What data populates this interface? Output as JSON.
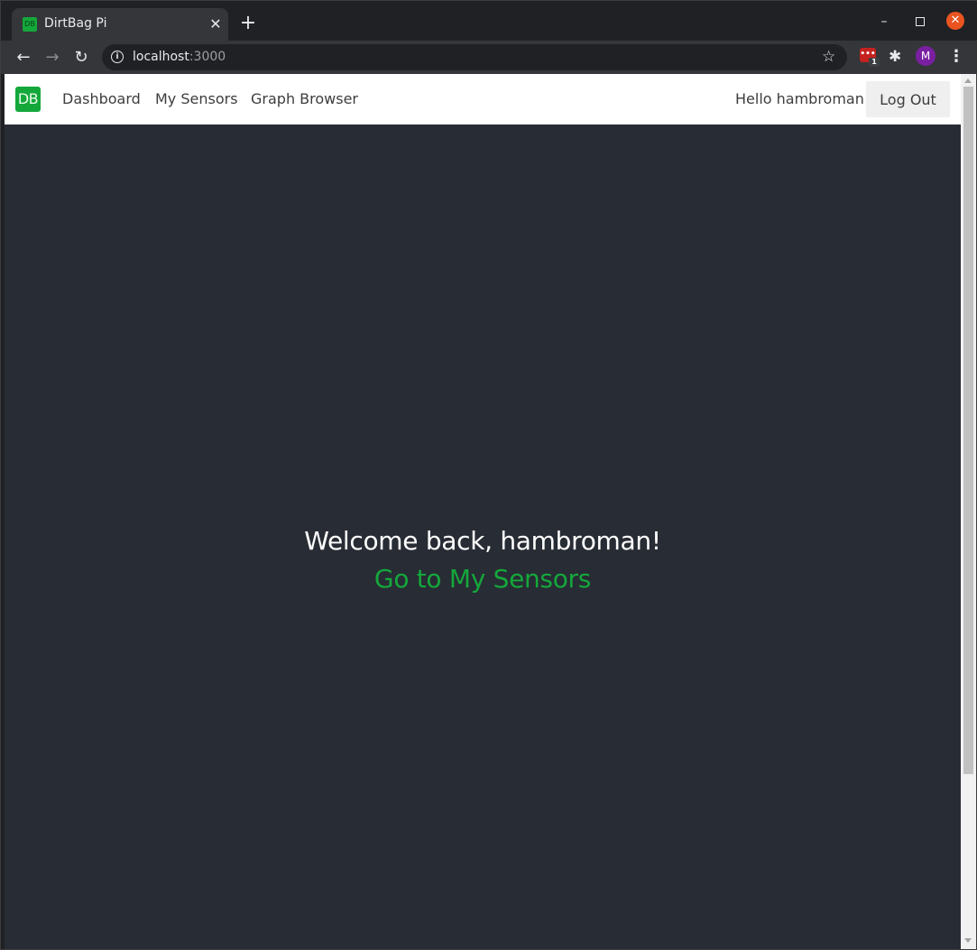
{
  "browser": {
    "tab_title": "DirtBag Pi",
    "tab_favicon_text": "DB",
    "url_host": "localhost",
    "url_port": ":3000",
    "new_tab_glyph": "+",
    "close_tab_glyph": "✕",
    "extension_badge": "1",
    "profile_initial": "M"
  },
  "navbar": {
    "brand": "DB",
    "links": [
      "Dashboard",
      "My Sensors",
      "Graph Browser"
    ],
    "greeting": "Hello hambroman",
    "logout_label": "Log Out"
  },
  "main": {
    "welcome": "Welcome back, hambroman!",
    "cta_link": "Go to My Sensors"
  },
  "colors": {
    "accent": "#14a83b",
    "page_background": "#282c34",
    "navbar_background": "#ffffff",
    "browser_chrome": "#35363a"
  },
  "icons": [
    "back-arrow-icon",
    "forward-arrow-icon",
    "reload-icon",
    "info-icon",
    "star-icon",
    "extension-icon",
    "puzzle-icon",
    "kebab-menu-icon",
    "close-window-icon",
    "minimize-icon",
    "maximize-icon"
  ]
}
